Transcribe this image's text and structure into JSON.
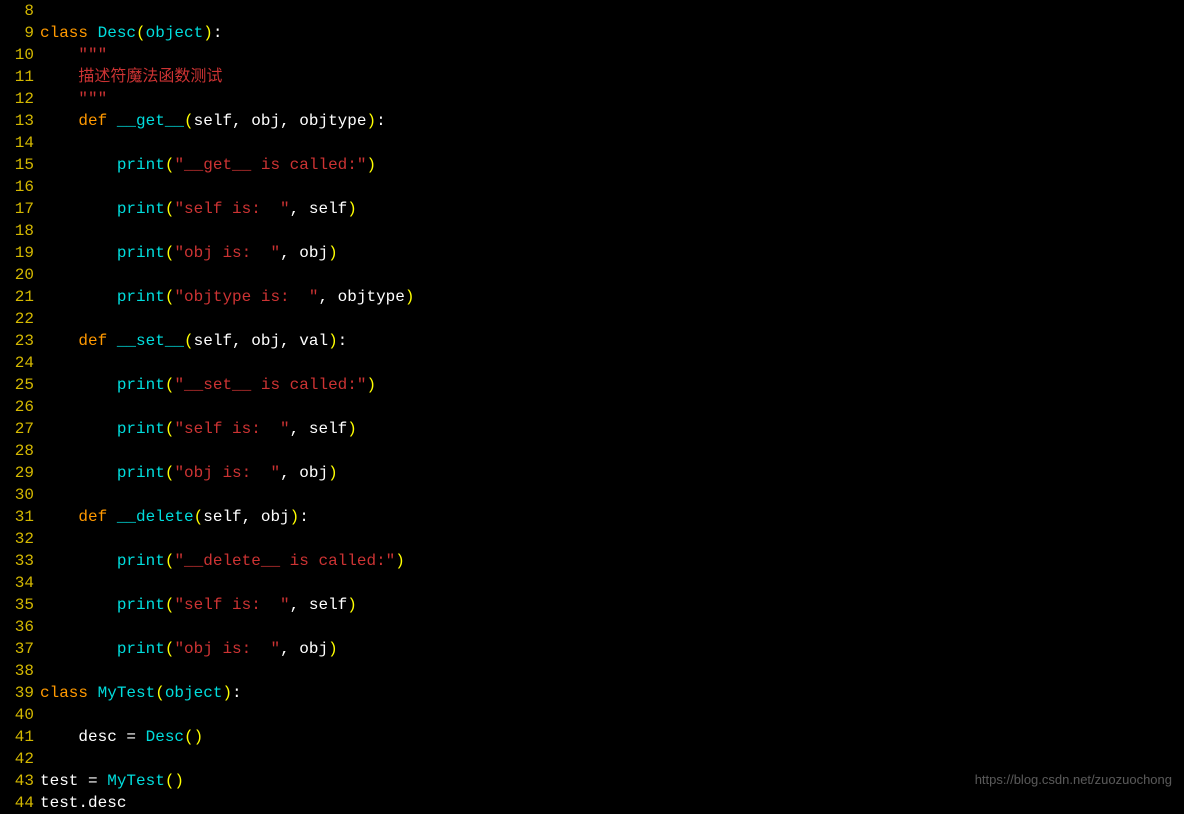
{
  "watermark": "https://blog.csdn.net/zuozuochong",
  "lines": [
    {
      "no": "8",
      "tokens": []
    },
    {
      "no": "9",
      "tokens": [
        {
          "c": "kw",
          "t": "class "
        },
        {
          "c": "cls",
          "t": "Desc"
        },
        {
          "c": "paren",
          "t": "("
        },
        {
          "c": "builtin",
          "t": "object"
        },
        {
          "c": "paren",
          "t": ")"
        },
        {
          "c": "punct",
          "t": ":"
        }
      ]
    },
    {
      "no": "10",
      "tokens": [
        {
          "c": "",
          "t": "    "
        },
        {
          "c": "docq",
          "t": "\"\"\""
        }
      ]
    },
    {
      "no": "11",
      "tokens": [
        {
          "c": "",
          "t": "    "
        },
        {
          "c": "doctext",
          "t": "描述符魔法函数测试"
        }
      ]
    },
    {
      "no": "12",
      "tokens": [
        {
          "c": "",
          "t": "    "
        },
        {
          "c": "docq",
          "t": "\"\"\""
        }
      ]
    },
    {
      "no": "13",
      "tokens": [
        {
          "c": "",
          "t": "    "
        },
        {
          "c": "kw",
          "t": "def "
        },
        {
          "c": "dunder",
          "t": "__get__"
        },
        {
          "c": "paren",
          "t": "("
        },
        {
          "c": "param",
          "t": "self, obj, objtype"
        },
        {
          "c": "paren",
          "t": ")"
        },
        {
          "c": "punct",
          "t": ":"
        }
      ]
    },
    {
      "no": "14",
      "tokens": []
    },
    {
      "no": "15",
      "tokens": [
        {
          "c": "",
          "t": "        "
        },
        {
          "c": "fn",
          "t": "print"
        },
        {
          "c": "paren",
          "t": "("
        },
        {
          "c": "str",
          "t": "\"__get__ is called:\""
        },
        {
          "c": "paren",
          "t": ")"
        }
      ]
    },
    {
      "no": "16",
      "tokens": []
    },
    {
      "no": "17",
      "tokens": [
        {
          "c": "",
          "t": "        "
        },
        {
          "c": "fn",
          "t": "print"
        },
        {
          "c": "paren",
          "t": "("
        },
        {
          "c": "str",
          "t": "\"self is:  \""
        },
        {
          "c": "punct",
          "t": ", "
        },
        {
          "c": "ident",
          "t": "self"
        },
        {
          "c": "paren",
          "t": ")"
        }
      ]
    },
    {
      "no": "18",
      "tokens": []
    },
    {
      "no": "19",
      "tokens": [
        {
          "c": "",
          "t": "        "
        },
        {
          "c": "fn",
          "t": "print"
        },
        {
          "c": "paren",
          "t": "("
        },
        {
          "c": "str",
          "t": "\"obj is:  \""
        },
        {
          "c": "punct",
          "t": ", "
        },
        {
          "c": "ident",
          "t": "obj"
        },
        {
          "c": "paren",
          "t": ")"
        }
      ]
    },
    {
      "no": "20",
      "tokens": []
    },
    {
      "no": "21",
      "tokens": [
        {
          "c": "",
          "t": "        "
        },
        {
          "c": "fn",
          "t": "print"
        },
        {
          "c": "paren",
          "t": "("
        },
        {
          "c": "str",
          "t": "\"objtype is:  \""
        },
        {
          "c": "punct",
          "t": ", "
        },
        {
          "c": "ident",
          "t": "objtype"
        },
        {
          "c": "paren",
          "t": ")"
        }
      ]
    },
    {
      "no": "22",
      "tokens": []
    },
    {
      "no": "23",
      "tokens": [
        {
          "c": "",
          "t": "    "
        },
        {
          "c": "kw",
          "t": "def "
        },
        {
          "c": "dunder",
          "t": "__set__"
        },
        {
          "c": "paren",
          "t": "("
        },
        {
          "c": "param",
          "t": "self, obj, val"
        },
        {
          "c": "paren",
          "t": ")"
        },
        {
          "c": "punct",
          "t": ":"
        }
      ]
    },
    {
      "no": "24",
      "tokens": []
    },
    {
      "no": "25",
      "tokens": [
        {
          "c": "",
          "t": "        "
        },
        {
          "c": "fn",
          "t": "print"
        },
        {
          "c": "paren",
          "t": "("
        },
        {
          "c": "str",
          "t": "\"__set__ is called:\""
        },
        {
          "c": "paren",
          "t": ")"
        }
      ]
    },
    {
      "no": "26",
      "tokens": []
    },
    {
      "no": "27",
      "tokens": [
        {
          "c": "",
          "t": "        "
        },
        {
          "c": "fn",
          "t": "print"
        },
        {
          "c": "paren",
          "t": "("
        },
        {
          "c": "str",
          "t": "\"self is:  \""
        },
        {
          "c": "punct",
          "t": ", "
        },
        {
          "c": "ident",
          "t": "self"
        },
        {
          "c": "paren",
          "t": ")"
        }
      ]
    },
    {
      "no": "28",
      "tokens": []
    },
    {
      "no": "29",
      "tokens": [
        {
          "c": "",
          "t": "        "
        },
        {
          "c": "fn",
          "t": "print"
        },
        {
          "c": "paren",
          "t": "("
        },
        {
          "c": "str",
          "t": "\"obj is:  \""
        },
        {
          "c": "punct",
          "t": ", "
        },
        {
          "c": "ident",
          "t": "obj"
        },
        {
          "c": "paren",
          "t": ")"
        }
      ]
    },
    {
      "no": "30",
      "tokens": []
    },
    {
      "no": "31",
      "tokens": [
        {
          "c": "",
          "t": "    "
        },
        {
          "c": "kw",
          "t": "def "
        },
        {
          "c": "dunder",
          "t": "__delete"
        },
        {
          "c": "paren",
          "t": "("
        },
        {
          "c": "param",
          "t": "self, obj"
        },
        {
          "c": "paren",
          "t": ")"
        },
        {
          "c": "punct",
          "t": ":"
        }
      ]
    },
    {
      "no": "32",
      "tokens": []
    },
    {
      "no": "33",
      "tokens": [
        {
          "c": "",
          "t": "        "
        },
        {
          "c": "fn",
          "t": "print"
        },
        {
          "c": "paren",
          "t": "("
        },
        {
          "c": "str",
          "t": "\"__delete__ is called:\""
        },
        {
          "c": "paren",
          "t": ")"
        }
      ]
    },
    {
      "no": "34",
      "tokens": []
    },
    {
      "no": "35",
      "tokens": [
        {
          "c": "",
          "t": "        "
        },
        {
          "c": "fn",
          "t": "print"
        },
        {
          "c": "paren",
          "t": "("
        },
        {
          "c": "str",
          "t": "\"self is:  \""
        },
        {
          "c": "punct",
          "t": ", "
        },
        {
          "c": "ident",
          "t": "self"
        },
        {
          "c": "paren",
          "t": ")"
        }
      ]
    },
    {
      "no": "36",
      "tokens": []
    },
    {
      "no": "37",
      "tokens": [
        {
          "c": "",
          "t": "        "
        },
        {
          "c": "fn",
          "t": "print"
        },
        {
          "c": "paren",
          "t": "("
        },
        {
          "c": "str",
          "t": "\"obj is:  \""
        },
        {
          "c": "punct",
          "t": ", "
        },
        {
          "c": "ident",
          "t": "obj"
        },
        {
          "c": "paren",
          "t": ")"
        }
      ]
    },
    {
      "no": "38",
      "tokens": []
    },
    {
      "no": "39",
      "tokens": [
        {
          "c": "kw",
          "t": "class "
        },
        {
          "c": "cls",
          "t": "MyTest"
        },
        {
          "c": "paren",
          "t": "("
        },
        {
          "c": "builtin",
          "t": "object"
        },
        {
          "c": "paren",
          "t": ")"
        },
        {
          "c": "punct",
          "t": ":"
        }
      ]
    },
    {
      "no": "40",
      "tokens": []
    },
    {
      "no": "41",
      "tokens": [
        {
          "c": "",
          "t": "    "
        },
        {
          "c": "ident",
          "t": "desc "
        },
        {
          "c": "op",
          "t": "= "
        },
        {
          "c": "cls",
          "t": "Desc"
        },
        {
          "c": "paren",
          "t": "()"
        }
      ]
    },
    {
      "no": "42",
      "tokens": []
    },
    {
      "no": "43",
      "tokens": [
        {
          "c": "ident",
          "t": "test "
        },
        {
          "c": "op",
          "t": "= "
        },
        {
          "c": "cls",
          "t": "MyTest"
        },
        {
          "c": "paren",
          "t": "()"
        }
      ]
    },
    {
      "no": "44",
      "tokens": [
        {
          "c": "ident",
          "t": "test.desc"
        }
      ]
    }
  ]
}
